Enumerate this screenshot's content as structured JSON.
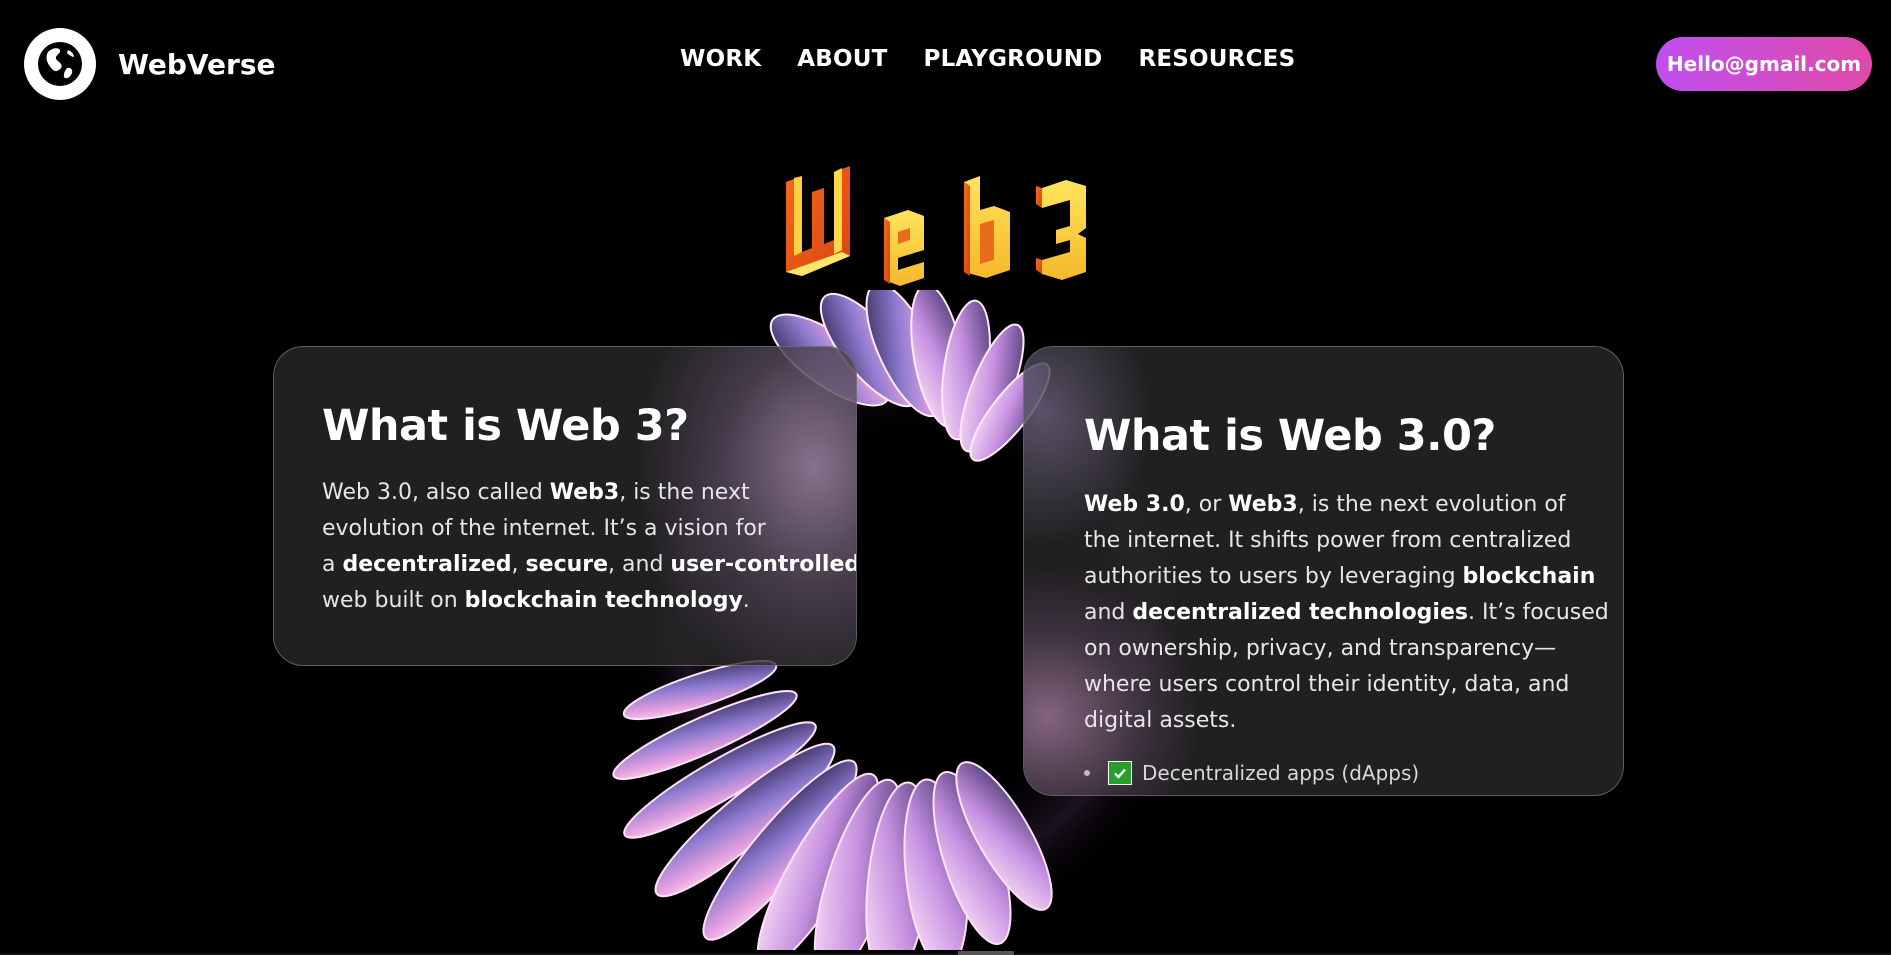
{
  "header": {
    "brand_name": "WebVerse",
    "nav": [
      "WORK",
      "ABOUT",
      "PLAYGROUND",
      "RESOURCES"
    ],
    "email_button": "Hello@gmail.com"
  },
  "hero": {
    "title": "Web3"
  },
  "card_left": {
    "title": "What is Web 3?",
    "lines": [
      [
        {
          "t": "Web 3.0, also called "
        },
        {
          "t": "Web3",
          "b": true
        },
        {
          "t": ", is the next"
        }
      ],
      [
        {
          "t": "evolution of the internet. It’s a vision for"
        }
      ],
      [
        {
          "t": "a "
        },
        {
          "t": "decentralized",
          "b": true
        },
        {
          "t": ", "
        },
        {
          "t": "secure",
          "b": true
        },
        {
          "t": ", and "
        },
        {
          "t": "user-controlled",
          "b": true
        }
      ],
      [
        {
          "t": "web built on "
        },
        {
          "t": "blockchain technology",
          "b": true
        },
        {
          "t": "."
        }
      ]
    ]
  },
  "card_right": {
    "title": "What is Web 3.0?",
    "lines": [
      [
        {
          "t": "Web 3.0",
          "b": true
        },
        {
          "t": ", or "
        },
        {
          "t": "Web3",
          "b": true
        },
        {
          "t": ", is the next evolution of"
        }
      ],
      [
        {
          "t": "the internet. It shifts power from centralized"
        }
      ],
      [
        {
          "t": "authorities to users by leveraging "
        },
        {
          "t": "blockchain",
          "b": true
        }
      ],
      [
        {
          "t": "and "
        },
        {
          "t": "decentralized technologies",
          "b": true
        },
        {
          "t": ". It’s focused"
        }
      ],
      [
        {
          "t": "on ownership, privacy, and transparency—"
        }
      ],
      [
        {
          "t": "where users control their identity, data, and"
        }
      ],
      [
        {
          "t": "digital assets."
        }
      ]
    ],
    "bullet": "Decentralized apps (dApps)"
  },
  "colors": {
    "accent_gradient_start": "#c04ff0",
    "accent_gradient_end": "#e04aa8",
    "title_gold": "#f7c531",
    "title_orange": "#f07a1c"
  },
  "icons": {
    "logo": "globe-icon",
    "bullet": "check-mark-icon"
  }
}
